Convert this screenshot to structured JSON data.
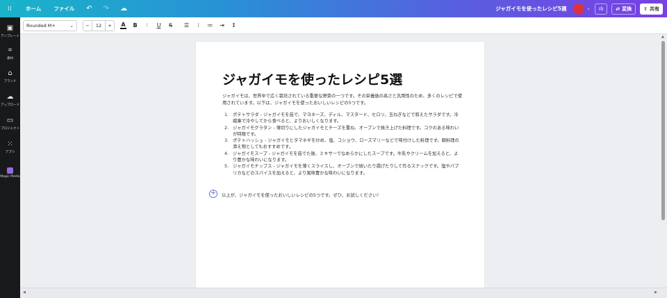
{
  "topbar": {
    "home": "ホーム",
    "file": "ファイル",
    "undo_icon": "undo-icon",
    "redo_icon": "redo-icon",
    "cloud_icon": "cloud-save-icon",
    "doc_title": "ジャガイモを使ったレシピ5選",
    "convert_label": "変換",
    "share_label": "共有"
  },
  "sidebar": {
    "items": [
      {
        "label": "テンプレート",
        "icon": "template-icon"
      },
      {
        "label": "素材",
        "icon": "elements-icon"
      },
      {
        "label": "ブランド",
        "icon": "brand-icon"
      },
      {
        "label": "アップロード",
        "icon": "upload-icon"
      },
      {
        "label": "プロジェクト",
        "icon": "folder-icon"
      },
      {
        "label": "アプリ",
        "icon": "apps-icon"
      },
      {
        "label": "Magic Media",
        "icon": "magic-media-icon"
      }
    ]
  },
  "toolbar": {
    "font": "Rounded M+",
    "font_size": "12",
    "minus": "−",
    "plus": "+",
    "bold": "B",
    "italic": "I",
    "underline": "U",
    "strike": "S"
  },
  "document": {
    "title": "ジャガイモを使ったレシピ5選",
    "intro": "ジャガイモは、世界中で広く栽培されている重要な野菜の一つです。その栄養価の高さと汎用性のため、多くのレシピで使用されています。以下は、ジャガイモを使ったおいしいレシピの5つです。",
    "list": [
      {
        "num": "1.",
        "text": "ポテトサラダ - ジャガイモを茹で、マヨネーズ、ディル、マスタード、セロリ、玉ねぎなどで和えたサラダです。冷蔵庫で冷やしてから食べると、よりおいしくなります。"
      },
      {
        "num": "2.",
        "text": "ジャガイモグラタン - 薄切りにしたジャガイモとチーズを重ね、オーブンで焼き上げた料理です。コクのある味わいが特徴です。"
      },
      {
        "num": "3.",
        "text": "ポテトハッシュ - ジャガイモとタマネギを炒め、塩、コショウ、ローズマリーなどで味付けした料理です。朝料理の添え物としてもおすすめです。"
      },
      {
        "num": "4.",
        "text": "ジャガイモスープ - ジャガイモを茹でた後、ミキサーでなめらかにしたスープです。牛乳やクリームを加えると、より豊かな味わいになります。"
      },
      {
        "num": "5.",
        "text": "ジャガイモチップス - ジャガイモを薄くスライスし、オーブンで焼いたり揚げたりして作るスナックです。塩やパプリカなどのスパイスを加えると、より風味豊かな味わいになります。"
      }
    ],
    "outro": "以上が、ジャガイモを使ったおいしいレシピの5つです。ぜひ、お試しください！"
  }
}
